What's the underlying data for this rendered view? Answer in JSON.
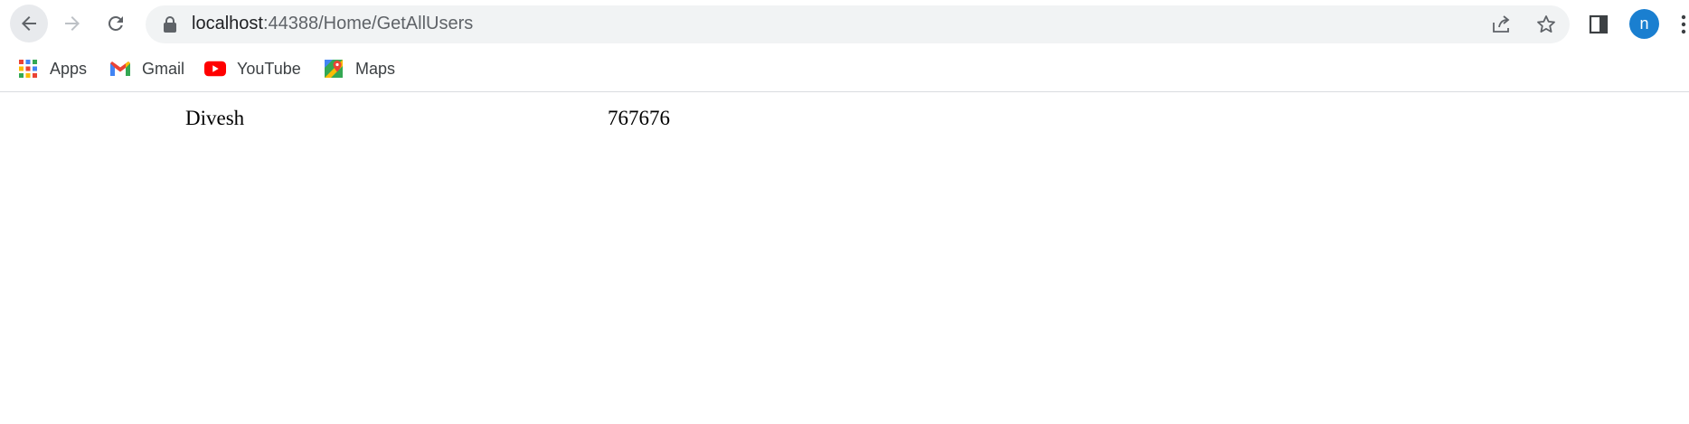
{
  "browser": {
    "url_host": "localhost",
    "url_path": ":44388/Home/GetAllUsers",
    "profile_initial": "n",
    "icons": {
      "back": "arrow-left-icon",
      "forward": "arrow-right-icon",
      "reload": "reload-icon",
      "lock": "lock-icon",
      "share": "share-icon",
      "bookmark": "star-icon",
      "side_panel": "side-panel-icon",
      "menu": "kebab-menu-icon"
    },
    "colors": {
      "avatar_bg": "#1a7fd0",
      "omnibox_bg": "#f1f3f4"
    }
  },
  "bookmarks": [
    {
      "label": "Apps",
      "icon": "apps-grid-icon"
    },
    {
      "label": "Gmail",
      "icon": "gmail-icon"
    },
    {
      "label": "YouTube",
      "icon": "youtube-icon"
    },
    {
      "label": "Maps",
      "icon": "maps-icon"
    }
  ],
  "page": {
    "rows": [
      {
        "name": "Divesh",
        "phone": "767676"
      }
    ]
  }
}
